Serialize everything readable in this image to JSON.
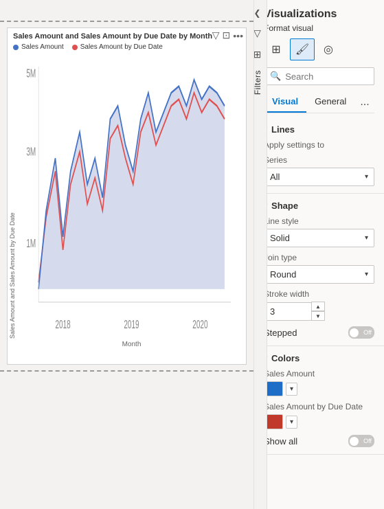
{
  "panel": {
    "title": "Visualizations",
    "format_visual": "Format visual",
    "icons": [
      {
        "name": "fields-icon",
        "symbol": "⊞"
      },
      {
        "name": "format-icon",
        "symbol": "🖌"
      },
      {
        "name": "analytics-icon",
        "symbol": "◎"
      }
    ],
    "search_placeholder": "Search",
    "tabs": [
      {
        "label": "Visual",
        "active": true
      },
      {
        "label": "General",
        "active": false
      }
    ],
    "tab_more": "..."
  },
  "filters": {
    "label": "Filters",
    "filter_icon": "▽",
    "expand_icon": "⊞",
    "chevron": "❮"
  },
  "lines_section": {
    "title": "Lines",
    "apply_settings_label": "Apply settings to",
    "series_label": "Series",
    "series_value": "All"
  },
  "shape_section": {
    "title": "Shape",
    "line_style_label": "Line style",
    "line_style_value": "Solid",
    "join_type_label": "Join type",
    "join_type_value": "Round",
    "stroke_width_label": "Stroke width",
    "stroke_width_value": "3",
    "stepped_label": "Stepped",
    "stepped_on": false
  },
  "colors_section": {
    "title": "Colors",
    "sales_amount_label": "Sales Amount",
    "sales_amount_color": "#1e6ec8",
    "sales_by_due_date_label": "Sales Amount by Due Date",
    "sales_by_due_date_color": "#c0392b",
    "show_all_label": "Show all",
    "show_all_on": false
  },
  "chart": {
    "title": "Sales Amount and Sales Amount by Due Date by Month",
    "legend": [
      {
        "label": "Sales Amount",
        "color": "#4472c4"
      },
      {
        "label": "Sales Amount by Due Date",
        "color": "#e05050"
      }
    ],
    "x_label": "Month",
    "y_label": "Sales Amount and Sales Amount by Due Date",
    "x_ticks": [
      "2018",
      "2019",
      "2020"
    ],
    "y_ticks": [
      "5M",
      "3M",
      "1M"
    ]
  }
}
